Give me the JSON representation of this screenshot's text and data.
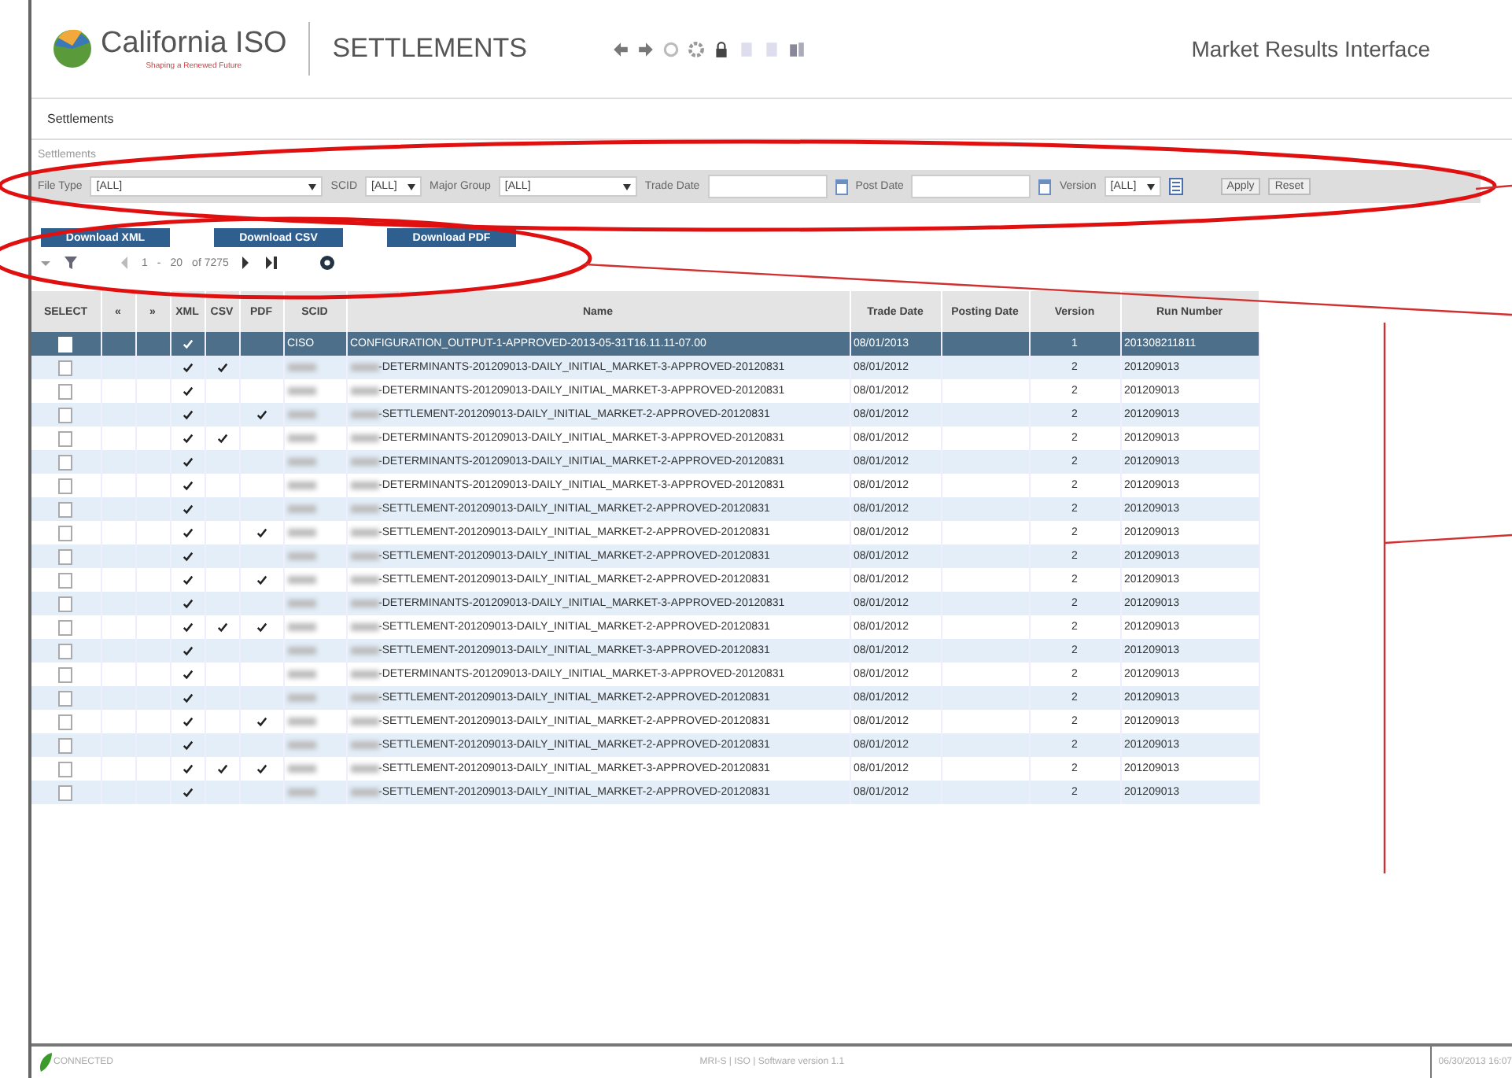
{
  "header": {
    "logo_name": "California ISO",
    "logo_tagline": "Shaping a Renewed Future",
    "app_title": "SETTLEMENTS",
    "interface_title": "Market Results Interface"
  },
  "nav_tab": "Settlements",
  "breadcrumb": "Settlements",
  "filters": [
    {
      "kind": "select",
      "label": "File Type",
      "value": "[ALL]"
    },
    {
      "kind": "select",
      "label": "SCID",
      "value": "[ALL]"
    },
    {
      "kind": "select",
      "label": "Major Group",
      "value": "[ALL]"
    },
    {
      "kind": "date",
      "label": "Trade Date"
    },
    {
      "kind": "date",
      "label": "Post Date"
    },
    {
      "kind": "select",
      "label": "Version",
      "value": "[ALL]"
    }
  ],
  "filter_buttons": [
    "Apply",
    "Reset"
  ],
  "download_buttons": [
    "Download XML",
    "Download CSV",
    "Download PDF"
  ],
  "pager": {
    "first": "1",
    "separator": "-",
    "page_size": "20",
    "of": "of 7275"
  },
  "table": {
    "columns": [
      "SELECT",
      "«",
      "»",
      "XML",
      "CSV",
      "PDF",
      "SCID",
      "Name",
      "Trade Date",
      "Posting Date",
      "Version",
      "Run Number"
    ],
    "rows": [
      {
        "selected": true,
        "xml": true,
        "csv": false,
        "pdf": false,
        "scid": "CISO",
        "redacted": false,
        "name": "CONFIGURATION_OUTPUT-1-APPROVED-2013-05-31T16.11.11-07.00",
        "trade_date": "08/01/2013",
        "version": "1",
        "run_number": "201308211811"
      },
      {
        "selected": false,
        "xml": true,
        "csv": true,
        "pdf": false,
        "redacted": true,
        "name": "-DETERMINANTS-201209013-DAILY_INITIAL_MARKET-3-APPROVED-20120831",
        "trade_date": "08/01/2012",
        "version": "2",
        "run_number": "201209013"
      },
      {
        "selected": false,
        "xml": true,
        "csv": false,
        "pdf": false,
        "redacted": true,
        "name": "-DETERMINANTS-201209013-DAILY_INITIAL_MARKET-3-APPROVED-20120831",
        "trade_date": "08/01/2012",
        "version": "2",
        "run_number": "201209013"
      },
      {
        "selected": false,
        "xml": true,
        "csv": false,
        "pdf": true,
        "redacted": true,
        "name": "-SETTLEMENT-201209013-DAILY_INITIAL_MARKET-2-APPROVED-20120831",
        "trade_date": "08/01/2012",
        "version": "2",
        "run_number": "201209013"
      },
      {
        "selected": false,
        "xml": true,
        "csv": true,
        "pdf": false,
        "redacted": true,
        "name": "-DETERMINANTS-201209013-DAILY_INITIAL_MARKET-3-APPROVED-20120831",
        "trade_date": "08/01/2012",
        "version": "2",
        "run_number": "201209013"
      },
      {
        "selected": false,
        "xml": true,
        "csv": false,
        "pdf": false,
        "redacted": true,
        "name": "-DETERMINANTS-201209013-DAILY_INITIAL_MARKET-2-APPROVED-20120831",
        "trade_date": "08/01/2012",
        "version": "2",
        "run_number": "201209013"
      },
      {
        "selected": false,
        "xml": true,
        "csv": false,
        "pdf": false,
        "redacted": true,
        "name": "-DETERMINANTS-201209013-DAILY_INITIAL_MARKET-3-APPROVED-20120831",
        "trade_date": "08/01/2012",
        "version": "2",
        "run_number": "201209013"
      },
      {
        "selected": false,
        "xml": true,
        "csv": false,
        "pdf": false,
        "redacted": true,
        "name": "-SETTLEMENT-201209013-DAILY_INITIAL_MARKET-2-APPROVED-20120831",
        "trade_date": "08/01/2012",
        "version": "2",
        "run_number": "201209013"
      },
      {
        "selected": false,
        "xml": true,
        "csv": false,
        "pdf": true,
        "redacted": true,
        "name": "-SETTLEMENT-201209013-DAILY_INITIAL_MARKET-2-APPROVED-20120831",
        "trade_date": "08/01/2012",
        "version": "2",
        "run_number": "201209013"
      },
      {
        "selected": false,
        "xml": true,
        "csv": false,
        "pdf": false,
        "redacted": true,
        "name": "-SETTLEMENT-201209013-DAILY_INITIAL_MARKET-2-APPROVED-20120831",
        "trade_date": "08/01/2012",
        "version": "2",
        "run_number": "201209013"
      },
      {
        "selected": false,
        "xml": true,
        "csv": false,
        "pdf": true,
        "redacted": true,
        "name": "-SETTLEMENT-201209013-DAILY_INITIAL_MARKET-2-APPROVED-20120831",
        "trade_date": "08/01/2012",
        "version": "2",
        "run_number": "201209013"
      },
      {
        "selected": false,
        "xml": true,
        "csv": false,
        "pdf": false,
        "redacted": true,
        "name": "-DETERMINANTS-201209013-DAILY_INITIAL_MARKET-3-APPROVED-20120831",
        "trade_date": "08/01/2012",
        "version": "2",
        "run_number": "201209013"
      },
      {
        "selected": false,
        "xml": true,
        "csv": true,
        "pdf": true,
        "redacted": true,
        "name": "-SETTLEMENT-201209013-DAILY_INITIAL_MARKET-2-APPROVED-20120831",
        "trade_date": "08/01/2012",
        "version": "2",
        "run_number": "201209013"
      },
      {
        "selected": false,
        "xml": true,
        "csv": false,
        "pdf": false,
        "redacted": true,
        "name": "-SETTLEMENT-201209013-DAILY_INITIAL_MARKET-3-APPROVED-20120831",
        "trade_date": "08/01/2012",
        "version": "2",
        "run_number": "201209013"
      },
      {
        "selected": false,
        "xml": true,
        "csv": false,
        "pdf": false,
        "redacted": true,
        "name": "-DETERMINANTS-201209013-DAILY_INITIAL_MARKET-3-APPROVED-20120831",
        "trade_date": "08/01/2012",
        "version": "2",
        "run_number": "201209013"
      },
      {
        "selected": false,
        "xml": true,
        "csv": false,
        "pdf": false,
        "redacted": true,
        "name": "-SETTLEMENT-201209013-DAILY_INITIAL_MARKET-2-APPROVED-20120831",
        "trade_date": "08/01/2012",
        "version": "2",
        "run_number": "201209013"
      },
      {
        "selected": false,
        "xml": true,
        "csv": false,
        "pdf": true,
        "redacted": true,
        "name": "-SETTLEMENT-201209013-DAILY_INITIAL_MARKET-2-APPROVED-20120831",
        "trade_date": "08/01/2012",
        "version": "2",
        "run_number": "201209013"
      },
      {
        "selected": false,
        "xml": true,
        "csv": false,
        "pdf": false,
        "redacted": true,
        "name": "-SETTLEMENT-201209013-DAILY_INITIAL_MARKET-2-APPROVED-20120831",
        "trade_date": "08/01/2012",
        "version": "2",
        "run_number": "201209013"
      },
      {
        "selected": false,
        "xml": true,
        "csv": true,
        "pdf": true,
        "redacted": true,
        "name": "-SETTLEMENT-201209013-DAILY_INITIAL_MARKET-3-APPROVED-20120831",
        "trade_date": "08/01/2012",
        "version": "2",
        "run_number": "201209013"
      },
      {
        "selected": false,
        "xml": true,
        "csv": false,
        "pdf": false,
        "redacted": true,
        "name": "-SETTLEMENT-201209013-DAILY_INITIAL_MARKET-2-APPROVED-20120831",
        "trade_date": "08/01/2012",
        "version": "2",
        "run_number": "201209013"
      }
    ]
  },
  "status_bar": {
    "connection": "CONNECTED",
    "center": "MRI-S | ISO | Software version 1.1",
    "right": "06/30/2013 16:07"
  }
}
